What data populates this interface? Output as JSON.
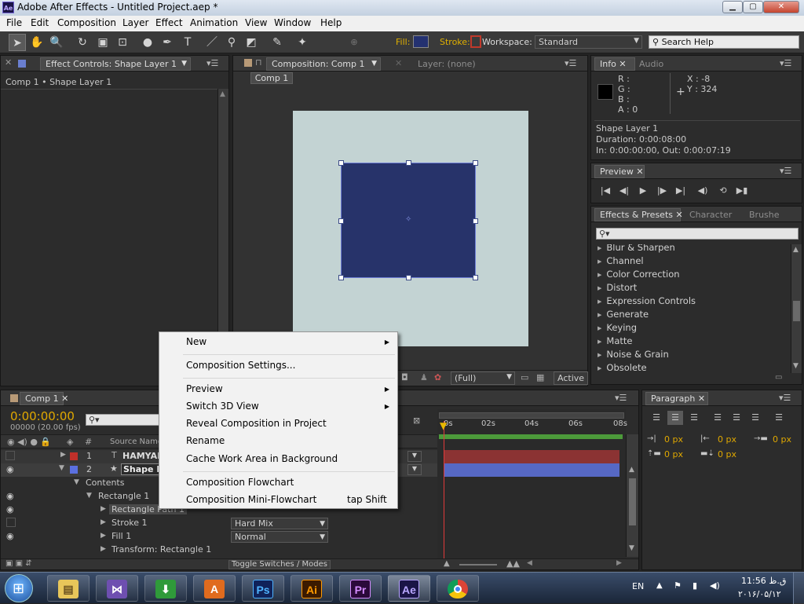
{
  "window": {
    "icon": "Ae",
    "title": "Adobe After Effects - Untitled Project.aep *",
    "min": "▁",
    "max": "▢",
    "close": "✕"
  },
  "menubar": {
    "items": [
      "File",
      "Edit",
      "Composition",
      "Layer",
      "Effect",
      "Animation",
      "View",
      "Window",
      "Help"
    ]
  },
  "toolbar": {
    "fill_label": "Fill:",
    "stroke_label": "Stroke:",
    "workspace_label": "Workspace:",
    "workspace_value": "Standard",
    "search_placeholder": "Search Help",
    "fill_color": "#243170",
    "stroke_color": "#c0392b"
  },
  "effect_controls": {
    "tab": "Effect Controls: Shape Layer 1",
    "breadcrumb": "Comp 1 • Shape Layer 1"
  },
  "composition": {
    "tab": "Composition: Comp 1",
    "layer_tab": "Layer: (none)",
    "comp_button": "Comp 1",
    "canvas_color": "#c3d3d3",
    "shape_color": "#27336a",
    "resolution": "(Full)",
    "camera": "Active C"
  },
  "info": {
    "tab": "Info",
    "audio_tab": "Audio",
    "r": "R :",
    "g": "G :",
    "b": "B :",
    "a": "A : 0",
    "x": "X : -8",
    "y": "Y : 324",
    "layer": "Shape Layer 1",
    "duration": "Duration: 0:00:08:00",
    "inout": "In: 0:00:00:00, Out: 0:00:07:19"
  },
  "preview": {
    "tab": "Preview"
  },
  "effects": {
    "tab": "Effects & Presets",
    "character_tab": "Character",
    "brushes_tab": "Brushe",
    "items": [
      "Blur & Sharpen",
      "Channel",
      "Color Correction",
      "Distort",
      "Expression Controls",
      "Generate",
      "Keying",
      "Matte",
      "Noise & Grain",
      "Obsolete"
    ]
  },
  "timeline": {
    "tab": "Comp 1",
    "timecode": "0:00:00:00",
    "fps": "00000 (20.00 fps)",
    "source_header": "Source Name",
    "hash_header": "#",
    "ruler": [
      "0s",
      "02s",
      "04s",
      "06s",
      "08s"
    ],
    "toggle": "Toggle Switches / Modes",
    "layer1_num": "1",
    "layer1_name": "HAMYAE",
    "layer2_num": "2",
    "layer2_name": "Shape La",
    "contents": "Contents",
    "rect": "Rectangle 1",
    "rect_path": "Rectangle Path 1",
    "stroke": "Stroke 1",
    "fill": "Fill 1",
    "transform": "Transform: Rectangle 1",
    "stroke_mode": "Hard Mix",
    "fill_mode": "Normal",
    "layer1_color": "#c0302a",
    "layer2_color": "#5b70e0",
    "bar1_color": "#8b3333",
    "bar2_color": "#5668c4"
  },
  "paragraph": {
    "tab": "Paragraph",
    "px": [
      "0 px",
      "0 px",
      "0 px",
      "0 px",
      "0 px"
    ]
  },
  "context_menu": {
    "new": "New",
    "comp_settings": "Composition Settings...",
    "preview": "Preview",
    "switch3d": "Switch 3D View",
    "reveal": "Reveal Composition in Project",
    "rename": "Rename",
    "cache": "Cache Work Area in Background",
    "flowchart": "Composition Flowchart",
    "mini_flowchart": "Composition Mini-Flowchart",
    "mini_shortcut": "tap Shift"
  },
  "taskbar": {
    "apps": [
      "Windows Explorer",
      "Visual Studio",
      "Internet Download Manager",
      "Acrobat",
      "Ps",
      "Ai",
      "Pr",
      "Ae",
      "Chrome"
    ],
    "lang": "EN",
    "time": "11:56 ق.ظ",
    "date": "۲۰۱۶/۰۵/۱۲"
  }
}
